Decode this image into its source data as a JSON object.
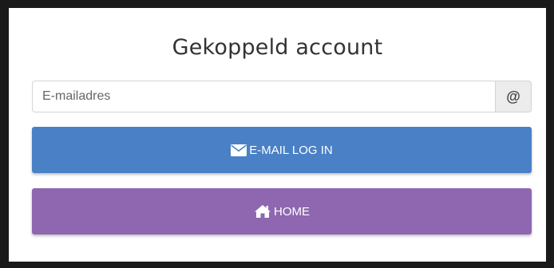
{
  "card": {
    "title": "Gekoppeld account"
  },
  "email": {
    "placeholder": "E-mailadres",
    "value": "",
    "addon_symbol": "@"
  },
  "buttons": {
    "email_login": {
      "label": "E-MAIL LOG IN",
      "icon": "envelope-icon",
      "color": "#4a80c6"
    },
    "home": {
      "label": "HOME",
      "icon": "home-icon",
      "color": "#8e67b0"
    }
  }
}
